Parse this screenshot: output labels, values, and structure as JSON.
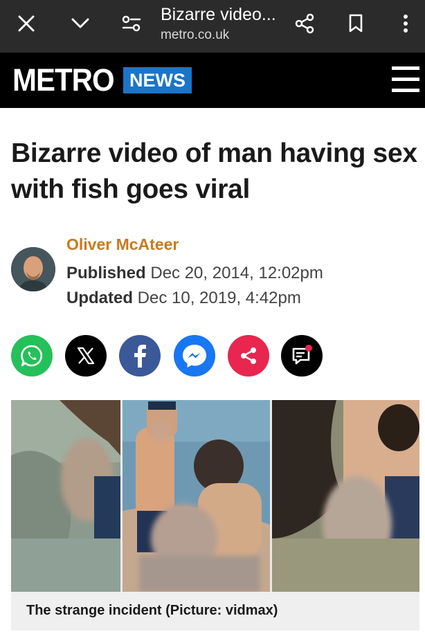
{
  "browser": {
    "title": "Bizarre video...",
    "url": "metro.co.uk",
    "icons": [
      "close-icon",
      "chevron-down-icon",
      "tune-icon",
      "share-icon",
      "bookmark-icon",
      "more-vert-icon"
    ]
  },
  "header": {
    "logo": "METRO",
    "section": "NEWS",
    "brand_color": "#1a75c9",
    "menu_icon": "hamburger-icon"
  },
  "article": {
    "headline": "Bizarre video of man having sex with fish goes viral",
    "author": "Oliver McAteer",
    "published_label": "Published",
    "published_value": "Dec 20, 2014, 12:02pm",
    "updated_label": "Updated",
    "updated_value": "Dec 10, 2019, 4:42pm",
    "author_color": "#c87a1f"
  },
  "share": {
    "buttons": [
      "whatsapp-icon",
      "x-icon",
      "facebook-icon",
      "messenger-icon",
      "share-icon",
      "comment-icon"
    ],
    "colors": [
      "#25c05a",
      "#000000",
      "#3b5998",
      "#1877f2",
      "#e8264f",
      "#000000"
    ]
  },
  "image": {
    "caption": "The strange incident (Picture: vidmax)"
  }
}
